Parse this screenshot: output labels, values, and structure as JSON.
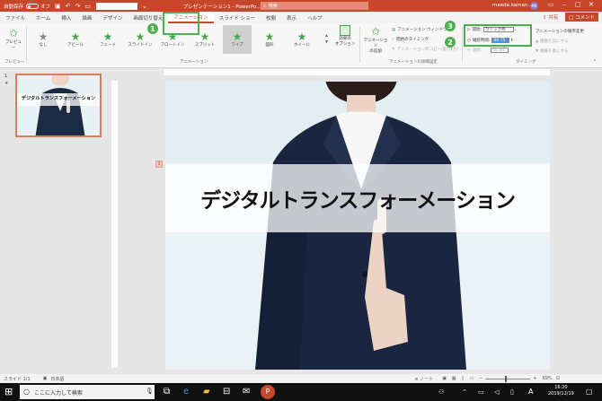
{
  "titlebar": {
    "autosave_label": "自動保存",
    "autosave_state": "オフ",
    "doc_title": "プレゼンテーション1 - PowerPo...",
    "search_placeholder": "検索",
    "user_name": "maeda kaman...",
    "user_initials": "MK",
    "colors": {
      "brand": "#c8472b",
      "accent_callout": "#4caf50"
    }
  },
  "tabs": [
    "ファイル",
    "ホーム",
    "挿入",
    "描画",
    "デザイン",
    "画面切り替え",
    "アニメーション",
    "スライド ショー",
    "校閲",
    "表示",
    "ヘルプ"
  ],
  "active_tab": "アニメーション",
  "share_label": "共有",
  "comment_label": "コメント",
  "ribbon": {
    "preview_label": "プレビュー",
    "preview_group": "プレビュー",
    "animations": [
      {
        "label": "なし",
        "icon": "none-star-icon"
      },
      {
        "label": "アピール",
        "icon": "star-icon"
      },
      {
        "label": "フェード",
        "icon": "star-icon"
      },
      {
        "label": "スライドイン",
        "icon": "star-icon"
      },
      {
        "label": "フロートイン",
        "icon": "star-icon"
      },
      {
        "label": "スプリット",
        "icon": "star-icon"
      },
      {
        "label": "ワイプ",
        "icon": "star-icon"
      },
      {
        "label": "図形",
        "icon": "star-icon"
      },
      {
        "label": "ホイール",
        "icon": "star-icon"
      }
    ],
    "selected_animation": "ワイプ",
    "effect_options_label": "効果の\nオプション",
    "animation_group": "アニメーション",
    "add_animation_label": "アニメーション\nの追加",
    "animation_pane_label": "アニメーション ウィンドウ",
    "trigger_label": "開始のタイミング",
    "painter_label": "アニメーションのコピー/貼り付け",
    "advanced_group": "アニメーションの詳細設定",
    "start_label": "開始:",
    "start_value": "クリック時",
    "duration_label": "継続時間:",
    "duration_value": "00.75",
    "delay_label": "遅延:",
    "delay_value": "00.00",
    "timing_group": "タイミング",
    "reorder_label": "アニメーションの順序変更",
    "move_earlier": "順番を前にする",
    "move_later": "順番を後にする",
    "callouts": [
      "1",
      "2",
      "3"
    ]
  },
  "thumbnails": [
    {
      "number": "1",
      "star": "★",
      "title": "デジタルトランスフォーメーション"
    }
  ],
  "slide": {
    "title": "デジタルトランスフォーメーション",
    "anim_tag": "1"
  },
  "statusbar": {
    "slide_info": "スライド 1/1",
    "language": "日本語",
    "notes_label": "ノート",
    "zoom": "69%"
  },
  "taskbar": {
    "search_placeholder": "ここに入力して検索",
    "time": "16:20",
    "date": "2019/12/19"
  }
}
